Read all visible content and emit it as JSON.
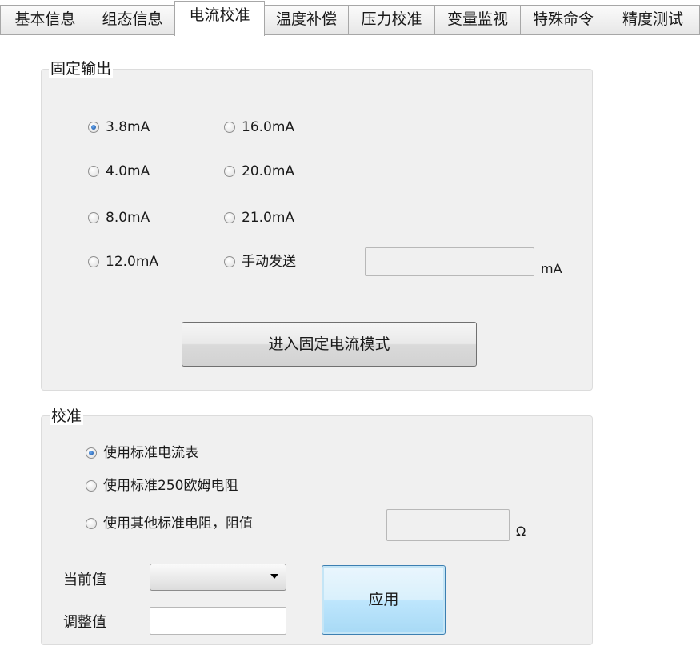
{
  "tabs": [
    {
      "label": "基本信息"
    },
    {
      "label": "组态信息"
    },
    {
      "label": "电流校准",
      "active": true
    },
    {
      "label": "温度补偿"
    },
    {
      "label": "压力校准"
    },
    {
      "label": "变量监视"
    },
    {
      "label": "特殊命令"
    },
    {
      "label": "精度测试"
    }
  ],
  "fixed_output": {
    "title": "固定输出",
    "options": [
      "3.8mA",
      "16.0mA",
      "4.0mA",
      "20.0mA",
      "8.0mA",
      "21.0mA",
      "12.0mA",
      "手动发送"
    ],
    "selected": "3.8mA",
    "manual_value": "",
    "unit": "mA",
    "enter_button": "进入固定电流模式"
  },
  "calibration": {
    "title": "校准",
    "options": [
      "使用标准电流表",
      "使用标准250欧姆电阻",
      "使用其他标准电阻，阻值"
    ],
    "selected": "使用标准电流表",
    "resistance_value": "",
    "resistance_unit": "Ω",
    "current_value_label": "当前值",
    "current_value": "",
    "adjust_value_label": "调整值",
    "adjust_value": "",
    "apply_button": "应用"
  }
}
